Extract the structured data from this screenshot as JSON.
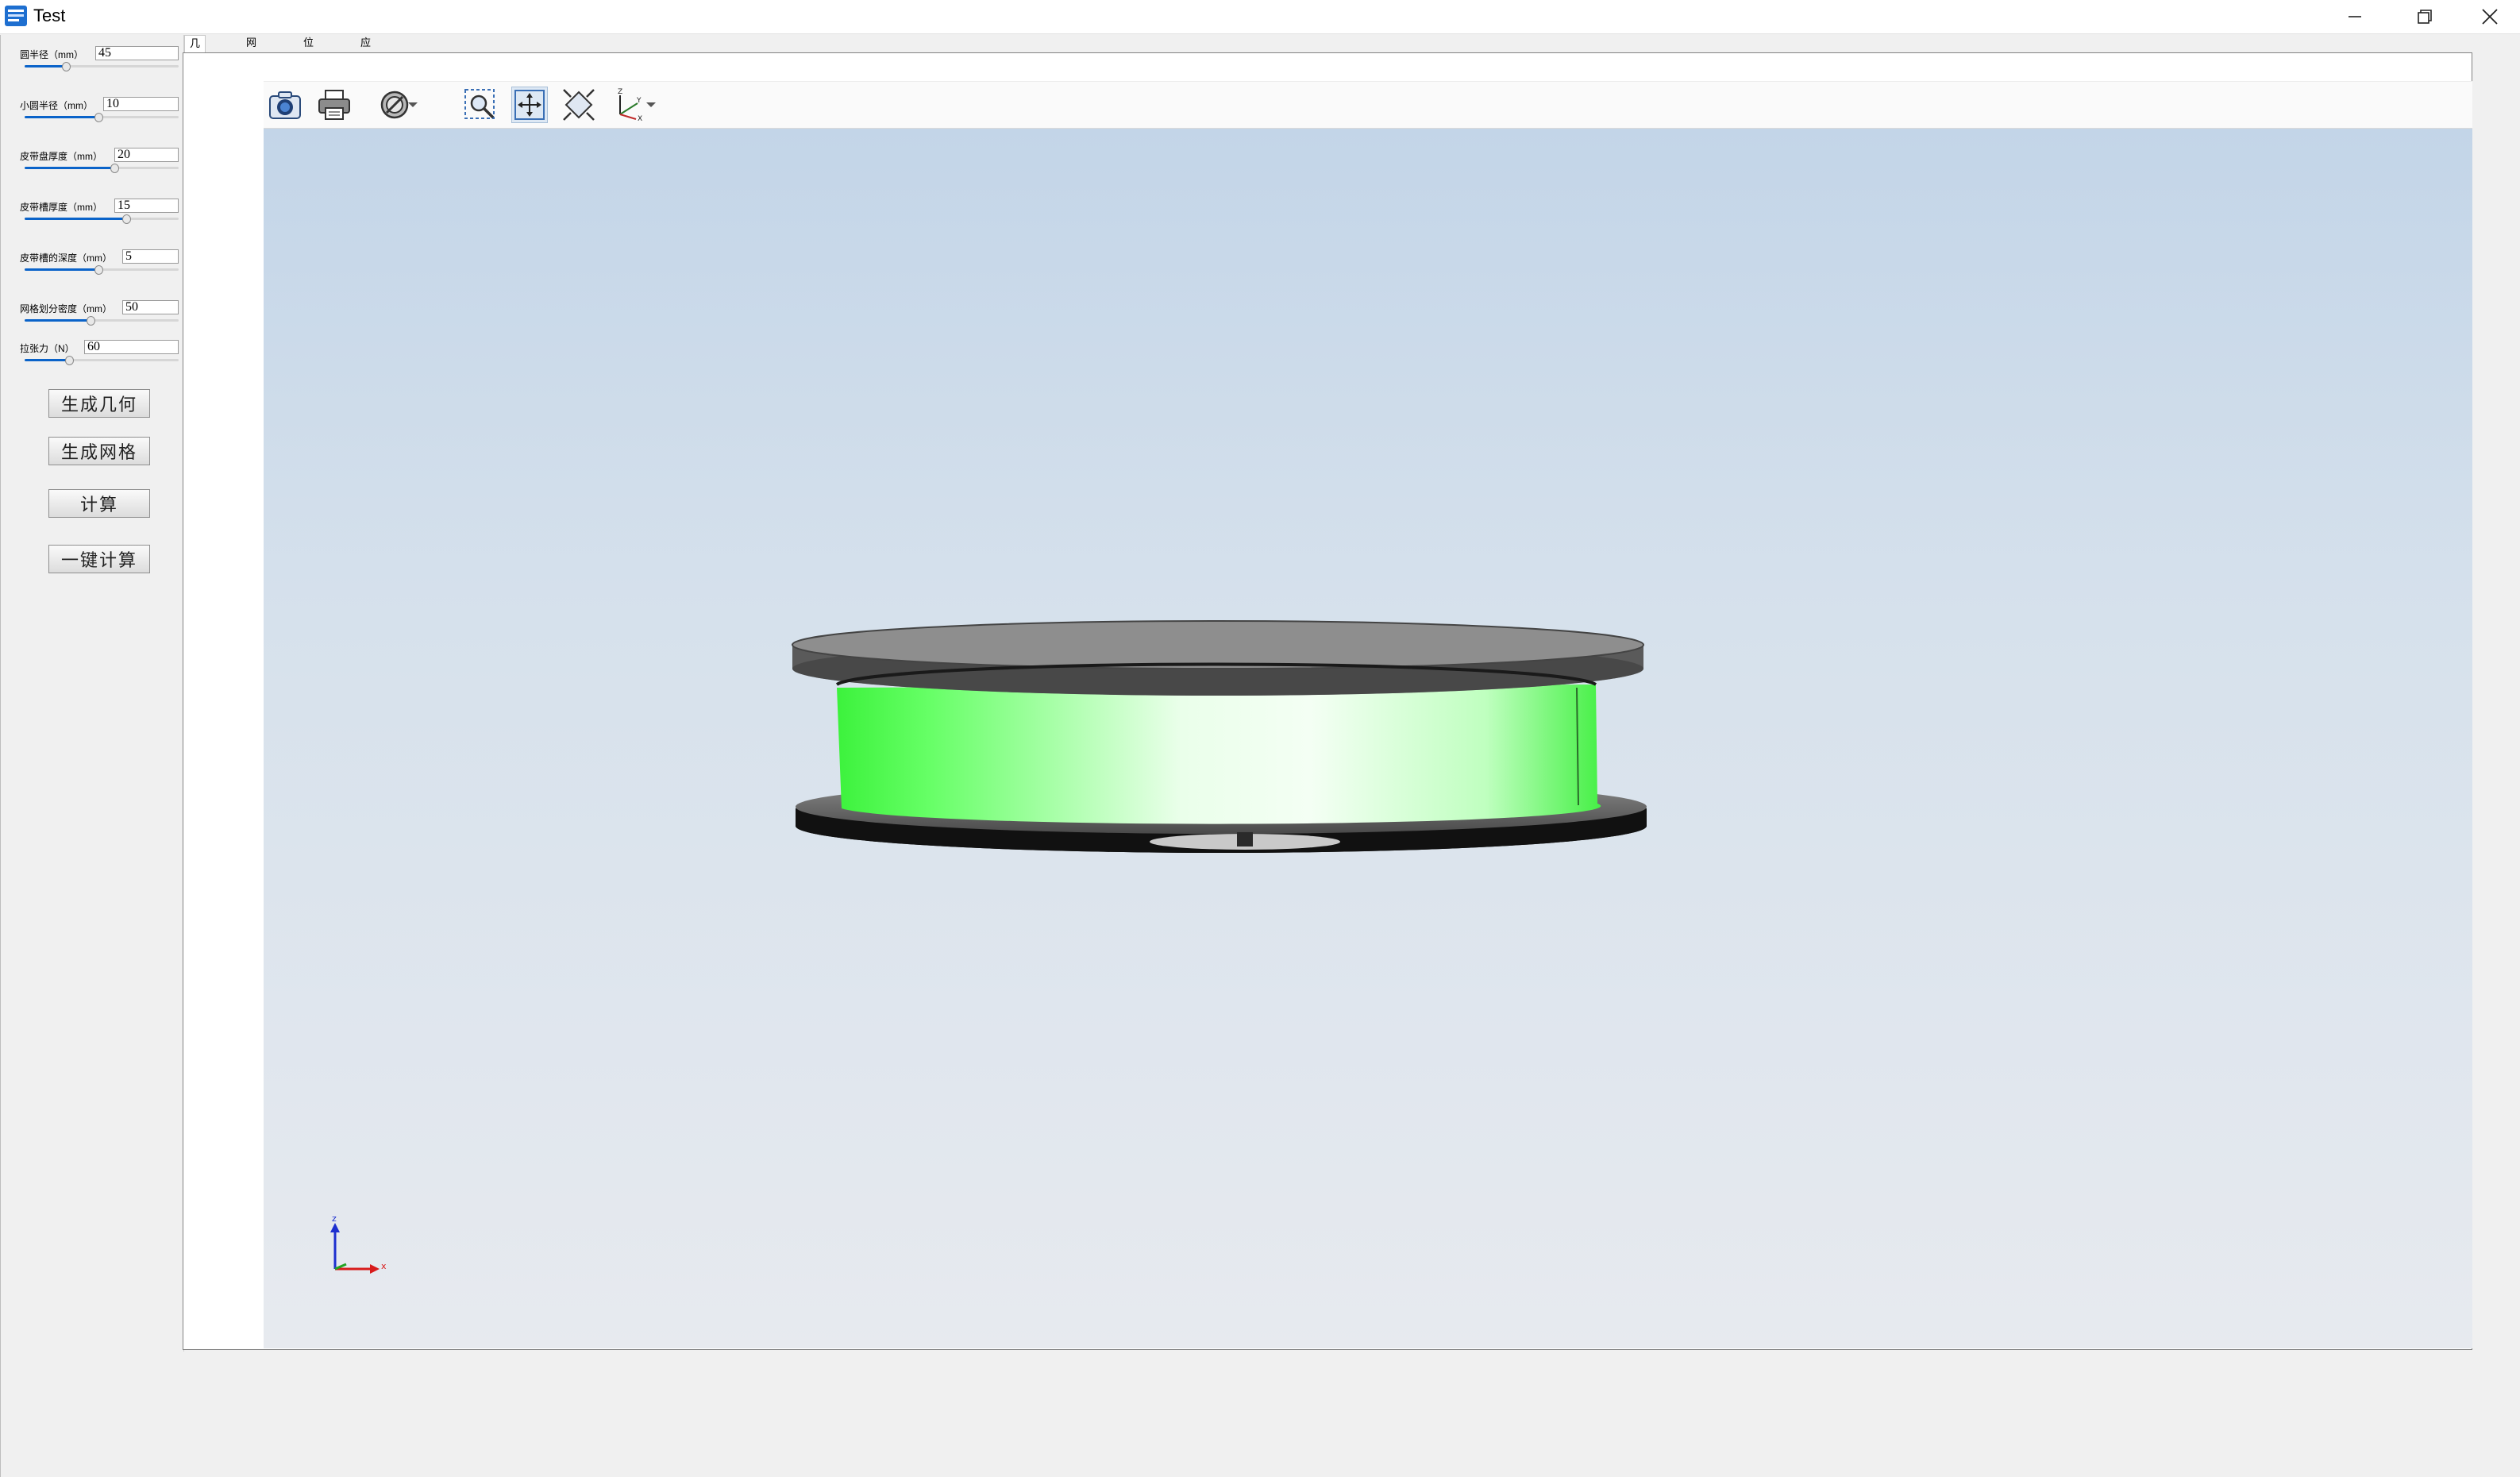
{
  "window": {
    "title": "Test",
    "minimize_icon": "minimize-icon",
    "restore_icon": "restore-icon",
    "close_icon": "close-icon"
  },
  "params": [
    {
      "label": "圆半径（mm）",
      "value": "45",
      "slider": 0.27
    },
    {
      "label": "小圆半径（mm）",
      "value": "10",
      "slider": 0.48
    },
    {
      "label": "皮带盘厚度（mm）",
      "value": "20",
      "slider": 0.58
    },
    {
      "label": "皮带槽厚度（mm）",
      "value": "15",
      "slider": 0.66
    },
    {
      "label": "皮带槽的深度（mm）",
      "value": "5",
      "slider": 0.48
    },
    {
      "label": "网格划分密度（mm）",
      "value": "50",
      "slider": 0.43
    },
    {
      "label": "拉张力（N）",
      "value": "60",
      "slider": 0.29
    }
  ],
  "buttons": {
    "gen_geometry": "生成几何",
    "gen_mesh": "生成网格",
    "compute": "计算",
    "one_click": "一键计算"
  },
  "tabs": [
    {
      "label": "几何图像",
      "active": true
    },
    {
      "label": "网格划分",
      "active": false
    },
    {
      "label": "位移云图",
      "active": false
    },
    {
      "label": "应力云图",
      "active": false
    }
  ],
  "toolbar": {
    "tools": [
      "camera-icon",
      "print-icon",
      "display-mode-icon",
      "dropdown-icon",
      "zoom-area-icon",
      "pan-icon",
      "fit-all-icon",
      "axes-icon",
      "dropdown-icon"
    ]
  },
  "axes": {
    "z": "z",
    "x": "x",
    "y": "Y"
  },
  "colors": {
    "pulley_body": "#4dff4d",
    "flange": "#5a5a5a",
    "accent": "#0a63c9"
  }
}
